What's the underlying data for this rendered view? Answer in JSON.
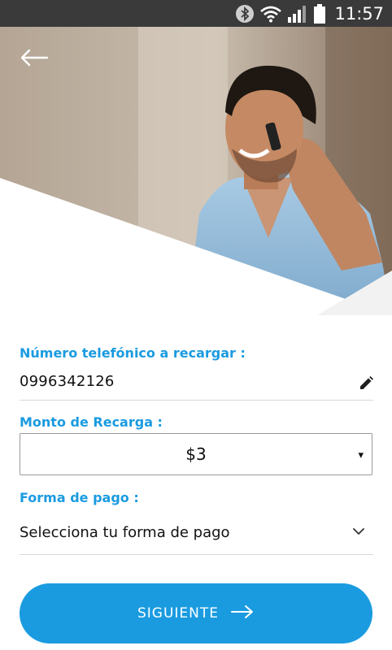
{
  "status_bar": {
    "time": "11:57",
    "icons": [
      "bluetooth-icon",
      "wifi-icon",
      "signal-icon",
      "battery-icon"
    ]
  },
  "header": {
    "back_icon": "arrow-left-icon"
  },
  "form": {
    "phone": {
      "label": "Número telefónico a recargar :",
      "value": "0996342126",
      "edit_icon": "pencil-icon"
    },
    "amount": {
      "label": "Monto de Recarga :",
      "selected": "$3",
      "caret": "▾"
    },
    "payment": {
      "label": "Forma de pago :",
      "placeholder": "Selecciona tu forma de pago",
      "chevron_icon": "chevron-down-icon"
    }
  },
  "next_button": {
    "label": "SIGUIENTE",
    "icon": "arrow-right-icon"
  },
  "colors": {
    "accent": "#1a9be0",
    "status_bar": "#3a3a3a",
    "text": "#111111"
  }
}
